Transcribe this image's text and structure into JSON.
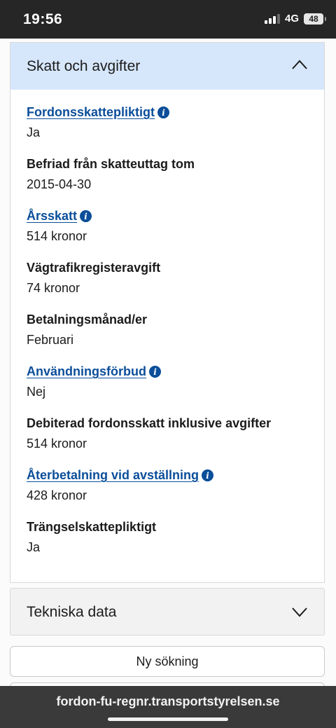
{
  "status": {
    "time": "19:56",
    "network": "4G",
    "battery": "48"
  },
  "section": {
    "title": "Skatt och avgifter",
    "fields": [
      {
        "label": "Fordonsskattepliktigt",
        "value": "Ja",
        "link": true,
        "info": true
      },
      {
        "label": "Befriad från skatteuttag tom",
        "value": "2015-04-30",
        "link": false,
        "info": false
      },
      {
        "label": "Årsskatt",
        "value": "514 kronor",
        "link": true,
        "info": true
      },
      {
        "label": "Vägtrafikregisteravgift",
        "value": "74 kronor",
        "link": false,
        "info": false
      },
      {
        "label": "Betalningsmånad/er",
        "value": "Februari",
        "link": false,
        "info": false
      },
      {
        "label": "Användningsförbud",
        "value": "Nej",
        "link": true,
        "info": true
      },
      {
        "label": "Debiterad fordonsskatt inklusive avgifter",
        "value": "514 kronor",
        "link": false,
        "info": false
      },
      {
        "label": "Återbetalning vid avställning",
        "value": "428 kronor",
        "link": true,
        "info": true
      },
      {
        "label": "Trängselskattepliktigt",
        "value": "Ja",
        "link": false,
        "info": false
      }
    ]
  },
  "tech": {
    "title": "Tekniska data"
  },
  "actions": {
    "new_search": "Ny sökning"
  },
  "browser": {
    "url": "fordon-fu-regnr.transportstyrelsen.se"
  },
  "icons": {
    "info": "i"
  }
}
